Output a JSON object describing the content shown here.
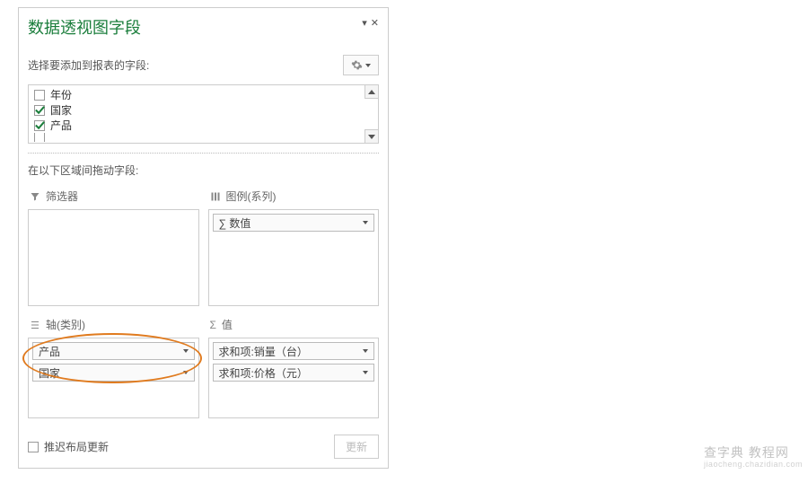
{
  "panel": {
    "title": "数据透视图字段",
    "sub_label": "选择要添加到报表的字段:"
  },
  "fields": {
    "items": [
      {
        "label": "年份",
        "checked": false
      },
      {
        "label": "国家",
        "checked": true
      },
      {
        "label": "产品",
        "checked": true
      }
    ],
    "overflow_hint": "…"
  },
  "drag_label": "在以下区域间拖动字段:",
  "areas": {
    "filters": {
      "title": "筛选器",
      "items": []
    },
    "legend": {
      "title": "图例(系列)",
      "items": [
        "∑ 数值"
      ]
    },
    "axis": {
      "title": "轴(类别)",
      "items": [
        "产品",
        "国家"
      ]
    },
    "values": {
      "title": "值",
      "items": [
        "求和项:销量（台）",
        "求和项:价格（元）"
      ]
    }
  },
  "footer": {
    "defer_label": "推迟布局更新",
    "update_label": "更新"
  },
  "watermark": {
    "main": "查字典 教程网",
    "sub": "jiaocheng.chazidian.com"
  }
}
